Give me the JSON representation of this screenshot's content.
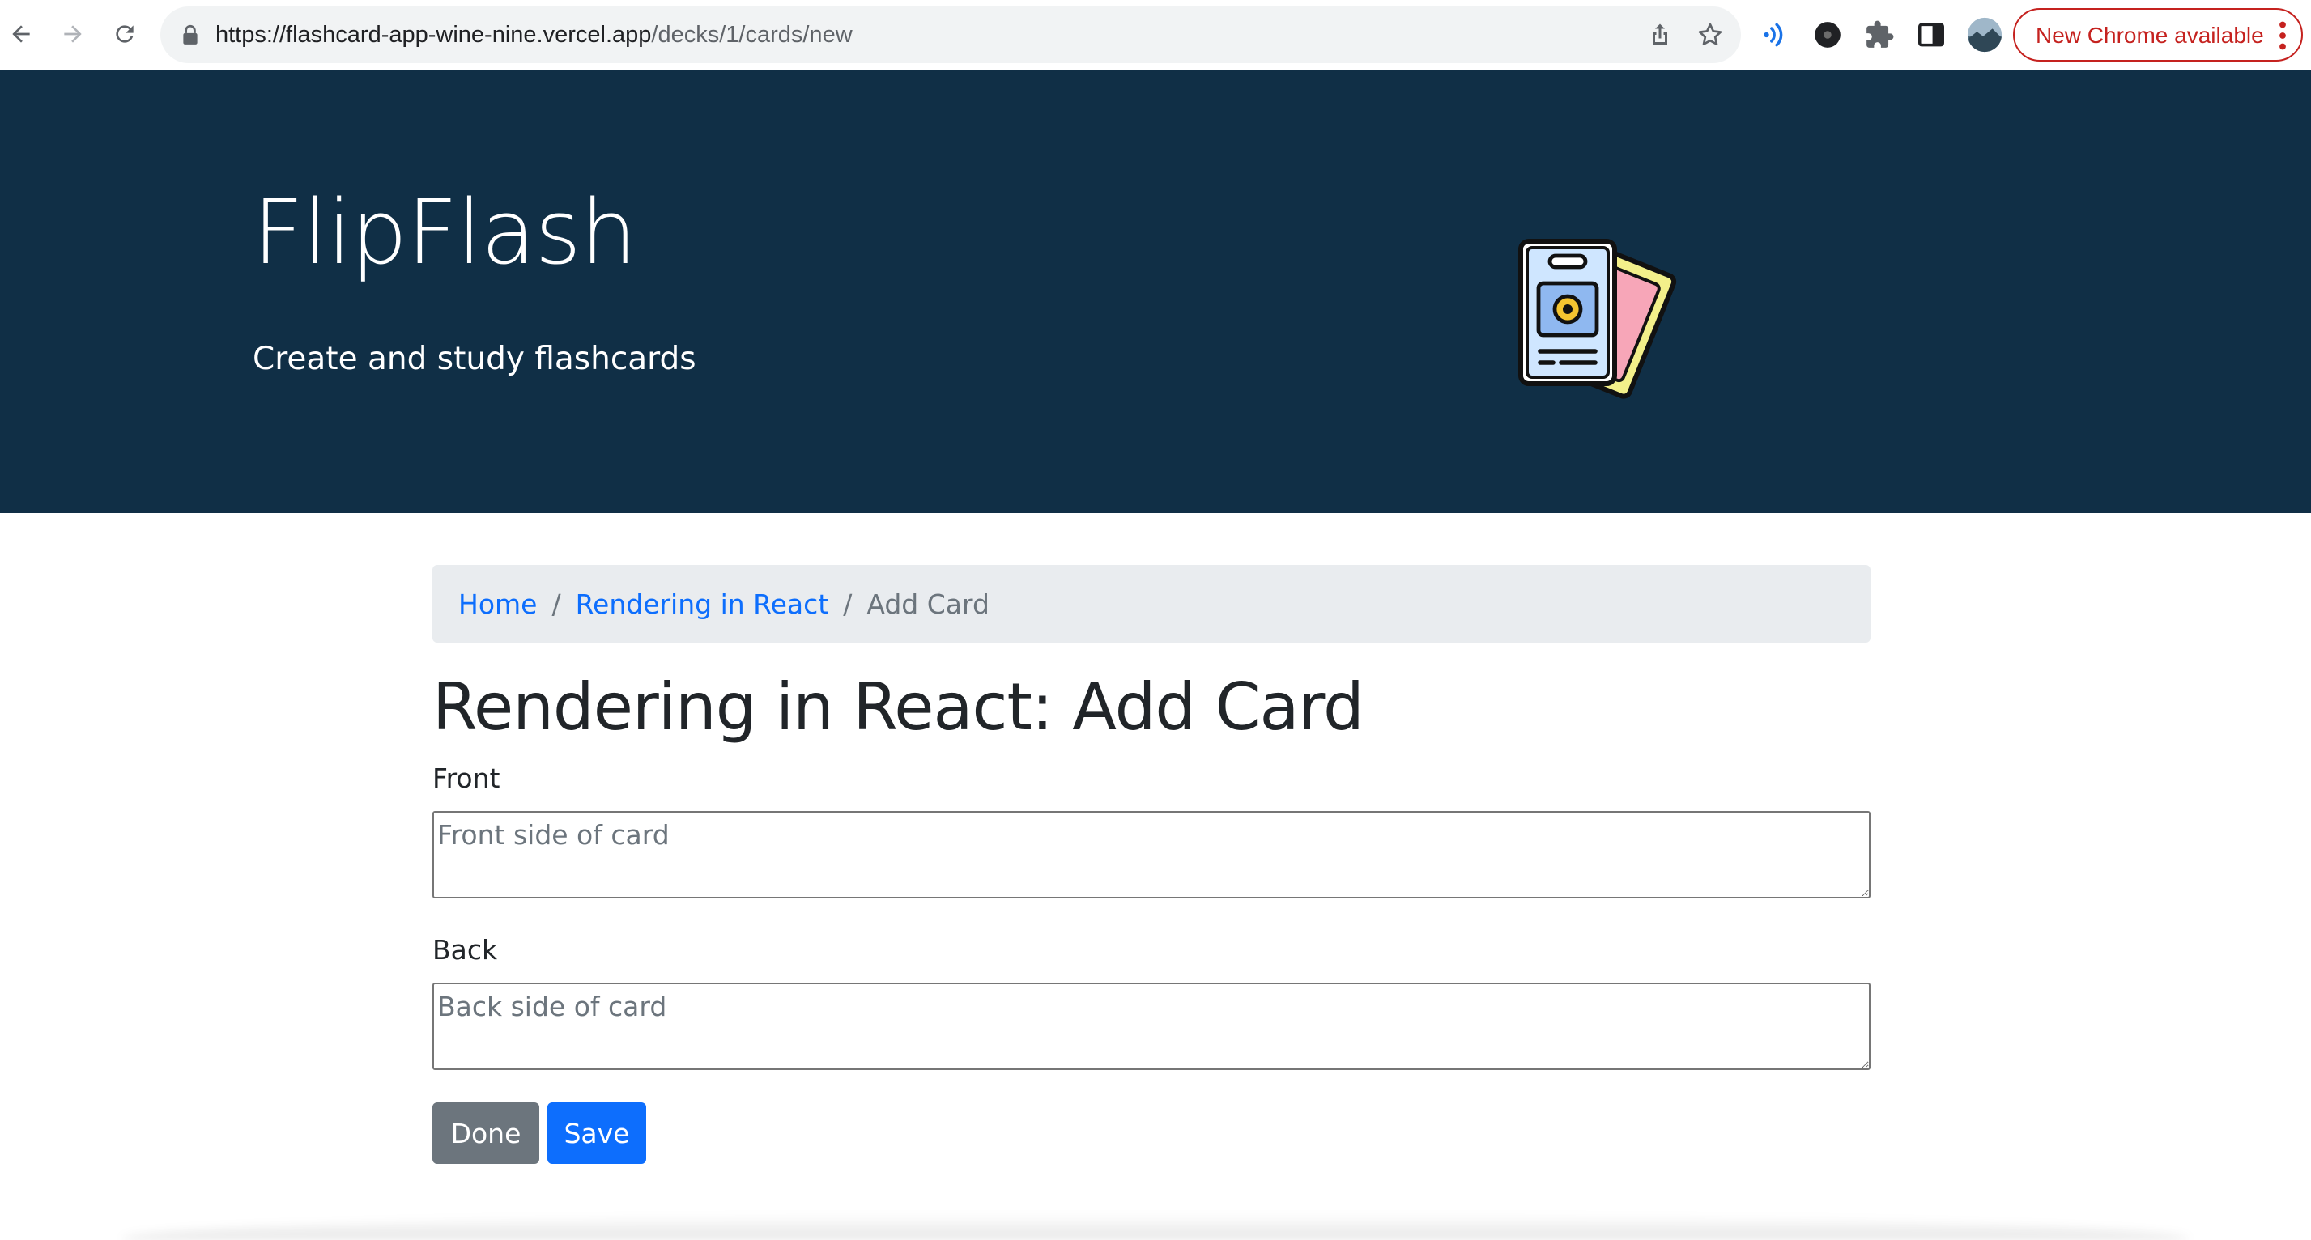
{
  "browser": {
    "url_host": "https://flashcard-app-wine-nine.vercel.app",
    "url_path": "/decks/1/cards/new",
    "update_button_label": "New Chrome available",
    "icons": [
      "back-arrow-icon",
      "forward-arrow-icon",
      "reload-icon",
      "lock-icon",
      "share-icon",
      "star-icon",
      "media-cast-icon",
      "extension-badge-icon",
      "puzzle-icon",
      "side-panel-icon",
      "profile-avatar-icon",
      "more-vertical-icon"
    ]
  },
  "header": {
    "brand": "FlipFlash",
    "tagline": "Create and study flashcards",
    "background_color": "#102f46",
    "logo_icon": "flashcards-logo-icon"
  },
  "breadcrumb": {
    "items": [
      {
        "label": "Home",
        "link": true
      },
      {
        "label": "Rendering in React",
        "link": true
      },
      {
        "label": "Add Card",
        "link": false
      }
    ],
    "separator": "/"
  },
  "main": {
    "title": "Rendering in React: Add Card",
    "front": {
      "label": "Front",
      "placeholder": "Front side of card",
      "value": ""
    },
    "back": {
      "label": "Back",
      "placeholder": "Back side of card",
      "value": ""
    },
    "done_label": "Done",
    "save_label": "Save"
  },
  "colors": {
    "link": "#0d6efd",
    "secondary_button": "#6c757d",
    "primary_button": "#0d6efd",
    "update_pill": "#c5221f"
  }
}
